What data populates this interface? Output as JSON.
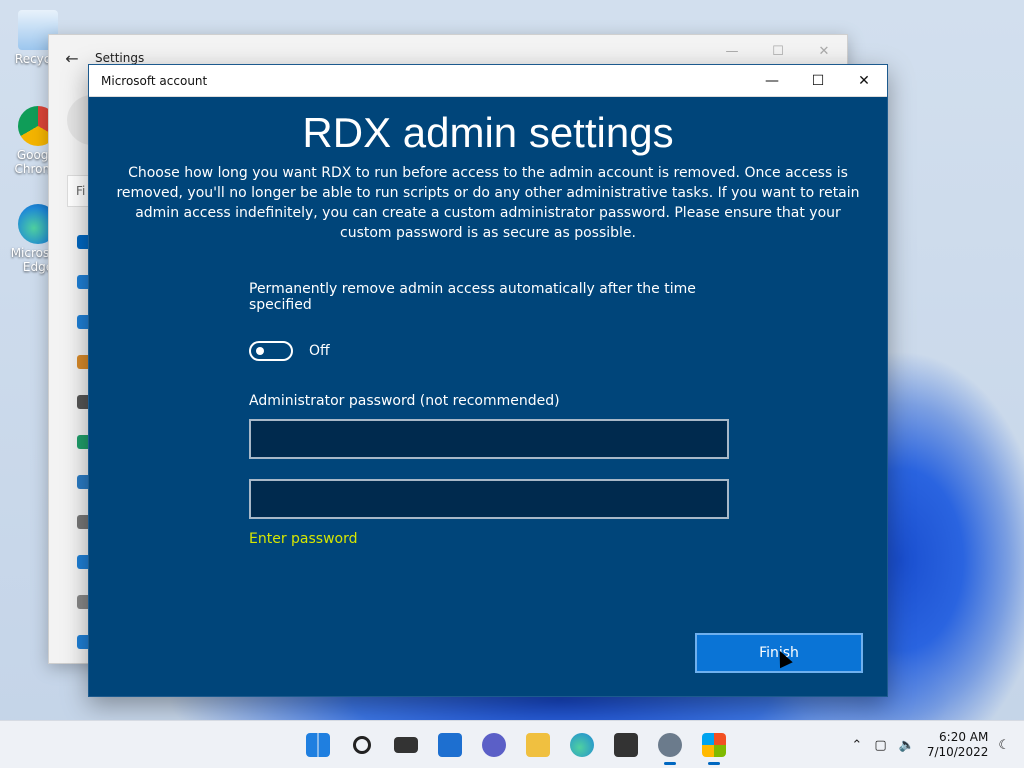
{
  "desktop": {
    "icons": [
      {
        "label": "Recycle",
        "color": "#5aa0e0"
      },
      {
        "label": "Google Chrome",
        "color": "#db4437"
      },
      {
        "label": "Microsoft Edge",
        "color": "#1e88d8"
      }
    ]
  },
  "settings_window": {
    "title": "Settings",
    "search_placeholder": "Fi"
  },
  "dialog": {
    "window_title": "Microsoft account",
    "heading": "RDX admin settings",
    "description": "Choose how long you want RDX to run before access to the admin account is removed. Once access is removed, you'll no longer be able to run scripts or do any other administrative tasks. If you want to retain admin access indefinitely, you can create a custom administrator password. Please ensure that your custom password is as secure as possible.",
    "toggle": {
      "label": "Permanently remove admin access automatically after the time specified",
      "state": "Off"
    },
    "password": {
      "label": "Administrator password (not recommended)",
      "value1": "",
      "value2": "",
      "hint": "Enter password"
    },
    "finish_label": "Finish"
  },
  "taskbar": {
    "time": "6:20 AM",
    "date": "7/10/2022"
  },
  "colors": {
    "dialog_bg": "#00457a",
    "button_accent": "#0a74d6",
    "hint": "#d7e600"
  }
}
